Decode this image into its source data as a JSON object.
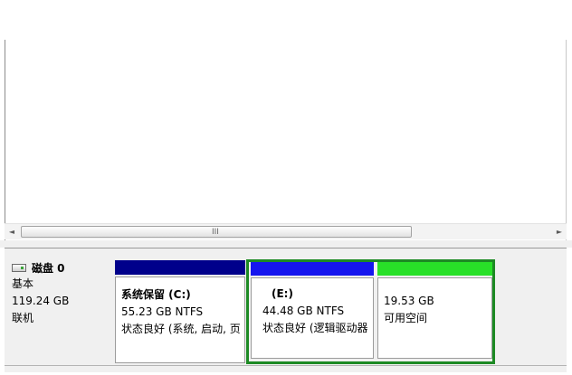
{
  "scrollbar": {
    "left_arrow": "◄",
    "right_arrow": "►",
    "grip": "III"
  },
  "disk": {
    "name": "磁盘 0",
    "type": "基本",
    "size": "119.24 GB",
    "status": "联机",
    "icon": "disk-drive-icon"
  },
  "partitions": [
    {
      "name": "系统保留 (C:)",
      "size": "55.23 GB NTFS",
      "status": "状态良好 (系统, 启动, 页",
      "bar_color": "#00008b"
    },
    {
      "name": "(E:)",
      "size": "44.48 GB NTFS",
      "status": "状态良好 (逻辑驱动器",
      "bar_color": "#1515ee"
    },
    {
      "size": "19.53 GB",
      "status": "可用空间",
      "bar_color": "#28e028"
    }
  ],
  "colors": {
    "extended_frame": "#1d8a24",
    "pane_background": "#f0f0f0"
  }
}
